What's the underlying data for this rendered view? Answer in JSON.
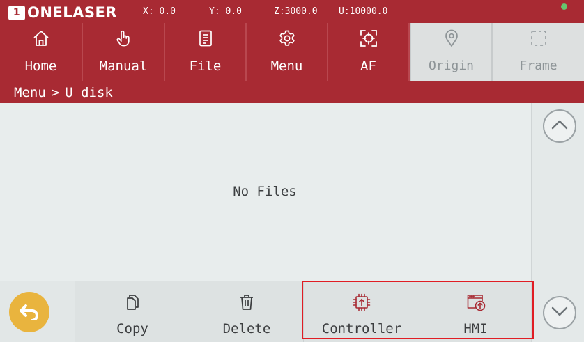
{
  "status": {
    "brand_mark": "1",
    "brand_name": "ONELASER",
    "x_label": "X:",
    "x_value": "0.0",
    "y_label": "Y:",
    "y_value": "0.0",
    "z_label": "Z:",
    "z_value": "3000.0",
    "u_label": "U:",
    "u_value": "10000.0"
  },
  "nav": {
    "home": "Home",
    "manual": "Manual",
    "file": "File",
    "menu": "Menu",
    "af": "AF",
    "origin": "Origin",
    "frame": "Frame"
  },
  "breadcrumb": {
    "parent": "Menu",
    "separator": ">",
    "current": "U disk"
  },
  "file_list": {
    "empty_text": "No Files"
  },
  "toolbar": {
    "copy": "Copy",
    "delete": "Delete",
    "controller": "Controller",
    "hmi": "HMI"
  },
  "icons": {
    "home": "home-icon",
    "manual": "hand-pointer-icon",
    "file": "document-icon",
    "menu": "gear-icon",
    "af": "autofocus-target-icon",
    "origin": "location-pin-icon",
    "frame": "dashed-frame-icon",
    "back": "undo-arrow-icon",
    "copy": "copy-icon",
    "delete": "trash-icon",
    "controller": "chip-upload-icon",
    "hmi": "window-upload-icon",
    "scroll_up": "chevron-up-icon",
    "scroll_down": "chevron-down-icon"
  },
  "colors": {
    "header": "#a82a33",
    "disabled_nav": "#dde0e0",
    "background": "#e7ecec",
    "back_button": "#e9b43e",
    "highlight": "#e01d24",
    "status_led": "#67c66e"
  }
}
